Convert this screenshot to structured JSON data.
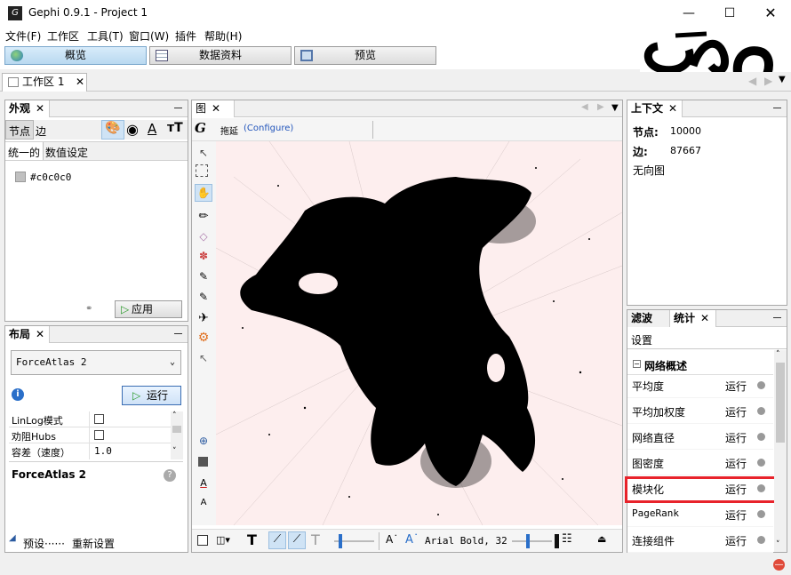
{
  "window": {
    "title": "Gephi 0.9.1 - Project 1",
    "app_icon": "gephi-icon"
  },
  "menu": [
    "文件(F)",
    "工作区",
    "工具(T)",
    "窗口(W)",
    "插件",
    "帮助(H)"
  ],
  "modes": [
    {
      "label": "概览",
      "icon": "globe-icon",
      "active": true
    },
    {
      "label": "数据资料",
      "icon": "table-icon",
      "active": false
    },
    {
      "label": "预览",
      "icon": "monitor-icon",
      "active": false
    }
  ],
  "workspace_tab": "工作区 1",
  "appearance": {
    "title": "外观",
    "tab_nodes": "节点",
    "tab_edges": "边",
    "sub_unique": "统一的",
    "sub_ranking": "数值设定",
    "color_value": "#c0c0c0",
    "color_swatch": "#c0c0c0",
    "apply_label": "应用"
  },
  "layout": {
    "title": "布局",
    "algorithm": "ForceAtlas 2",
    "run_label": "运行",
    "props": [
      {
        "name": "LinLog模式",
        "value": ""
      },
      {
        "name": "劝阻Hubs",
        "value": ""
      },
      {
        "name": "容差（速度）",
        "value": "1.0"
      }
    ],
    "desc_title": "ForceAtlas 2",
    "presets_label": "预设······",
    "reset_label": "重新设置"
  },
  "graph": {
    "tab": "图",
    "drag_label": "拖延",
    "configure_label": "(Configure)",
    "font_label": "Arial Bold, 32",
    "background": "#fdeeee"
  },
  "context": {
    "title": "上下文",
    "nodes_label": "节点:",
    "nodes_value": "10000",
    "edges_label": "边:",
    "edges_value": "87667",
    "graph_type": "无向图"
  },
  "statistics": {
    "filter_tab": "滤波",
    "stats_tab": "统计",
    "settings_label": "设置",
    "group_label": "网络概述",
    "run_label": "运行",
    "rows": [
      "平均度",
      "平均加权度",
      "网络直径",
      "图密度",
      "模块化",
      "PageRank",
      "连接组件"
    ],
    "highlight_index": 4,
    "highlight_color": "#e8232b"
  }
}
